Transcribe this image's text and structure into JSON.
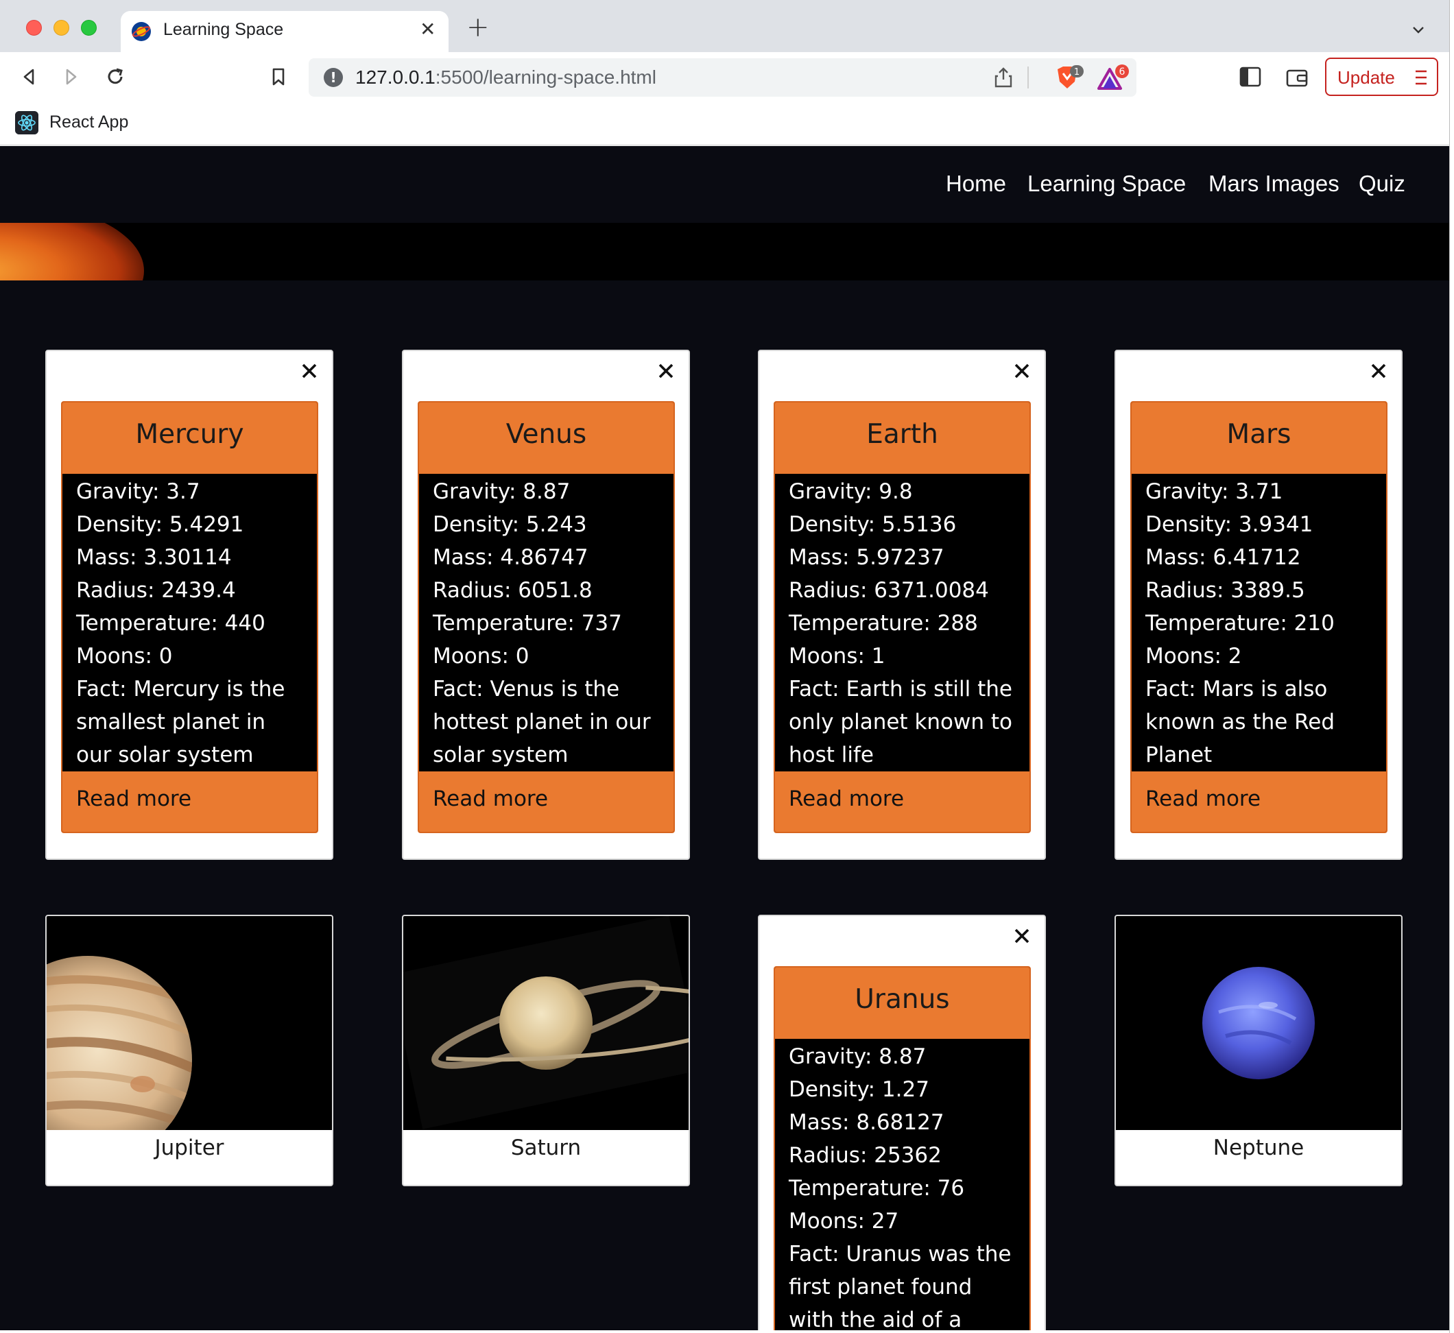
{
  "browser": {
    "tab_title": "Learning Space",
    "url_host": "127.0.0.1",
    "url_path": ":5500/learning-space.html",
    "bookmark_label": "React App",
    "update_label": "Update",
    "rewards_badge": "6",
    "shields_badge": "1"
  },
  "nav": {
    "links": [
      "Home",
      "Learning Space",
      "Mars Images",
      "Quiz"
    ]
  },
  "planets": [
    {
      "name": "Mercury",
      "gravity": "Gravity: 3.7",
      "density": "Density: 5.4291",
      "mass": "Mass: 3.30114",
      "radius": "Radius: 2439.4",
      "temperature": "Temperature: 440",
      "moons": "Moons: 0",
      "fact": "Fact: Mercury is the smallest planet in our solar system",
      "read_more": "Read more"
    },
    {
      "name": "Venus",
      "gravity": "Gravity: 8.87",
      "density": "Density: 5.243",
      "mass": "Mass: 4.86747",
      "radius": "Radius: 6051.8",
      "temperature": "Temperature: 737",
      "moons": "Moons: 0",
      "fact": "Fact: Venus is the hottest planet in our solar system",
      "read_more": "Read more"
    },
    {
      "name": "Earth",
      "gravity": "Gravity: 9.8",
      "density": "Density: 5.5136",
      "mass": "Mass: 5.97237",
      "radius": "Radius: 6371.0084",
      "temperature": "Temperature: 288",
      "moons": "Moons: 1",
      "fact": "Fact: Earth is still the only planet known to host life",
      "read_more": "Read more"
    },
    {
      "name": "Mars",
      "gravity": "Gravity: 3.71",
      "density": "Density: 3.9341",
      "mass": "Mass: 6.41712",
      "radius": "Radius: 3389.5",
      "temperature": "Temperature: 210",
      "moons": "Moons: 2",
      "fact": "Fact: Mars is also known as the Red Planet",
      "read_more": "Read more"
    },
    {
      "name": "Uranus",
      "gravity": "Gravity: 8.87",
      "density": "Density: 1.27",
      "mass": "Mass: 8.68127",
      "radius": "Radius: 25362",
      "temperature": "Temperature: 76",
      "moons": "Moons: 27",
      "fact": "Fact: Uranus was the first planet found with the aid of a telescope"
    }
  ],
  "image_cards": [
    {
      "name": "Jupiter"
    },
    {
      "name": "Saturn"
    },
    {
      "name": "Neptune"
    }
  ],
  "colors": {
    "accent_orange": "#ea7a30",
    "page_background": "#0a0b12"
  }
}
